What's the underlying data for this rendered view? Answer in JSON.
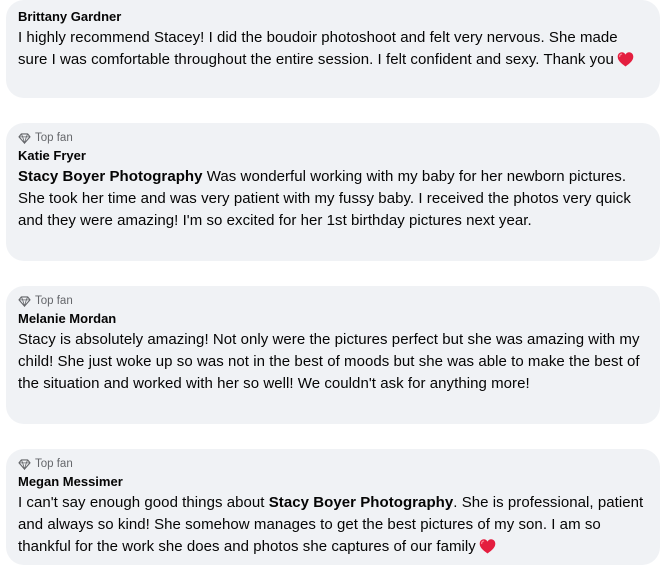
{
  "comments": [
    {
      "author": "Brittany Gardner",
      "text": "I highly recommend Stacey! I did the boudoir photoshoot and felt very nervous. She made sure I was comfortable throughout the entire session. I felt confident and sexy. Thank you",
      "emoji": "heart-emoji"
    },
    {
      "badge": "Top fan",
      "author": "Katie Fryer",
      "mention": "Stacy Boyer Photography",
      "text": " Was wonderful working with my baby for her newborn pictures. She took her time and was very patient with my fussy baby. I received the photos very quick and they were amazing! I'm so excited for her 1st birthday pictures next year."
    },
    {
      "badge": "Top fan",
      "author": "Melanie Mordan",
      "text": "Stacy is absolutely amazing! Not only were the pictures perfect but she was amazing with my child! She just woke up so was not in the best of moods but she was able to make the best of the situation and worked with her so well! We couldn't ask for anything more!"
    },
    {
      "badge": "Top fan",
      "author": "Megan Messimer",
      "text_before": "I can't say enough good things about ",
      "mention": "Stacy Boyer Photography",
      "text_after": ". She is professional, patient and always so kind! She somehow manages to get the best pictures of my son. I am so thankful for the work she does and photos she captures of our family",
      "emoji": "heart-emoji"
    }
  ],
  "colors": {
    "bubble_bg": "#f0f2f5",
    "badge_text": "#65676b",
    "heart": "#e41e3f"
  },
  "icons": {
    "top_fan": "diamond-icon",
    "heart": "heart-emoji"
  }
}
